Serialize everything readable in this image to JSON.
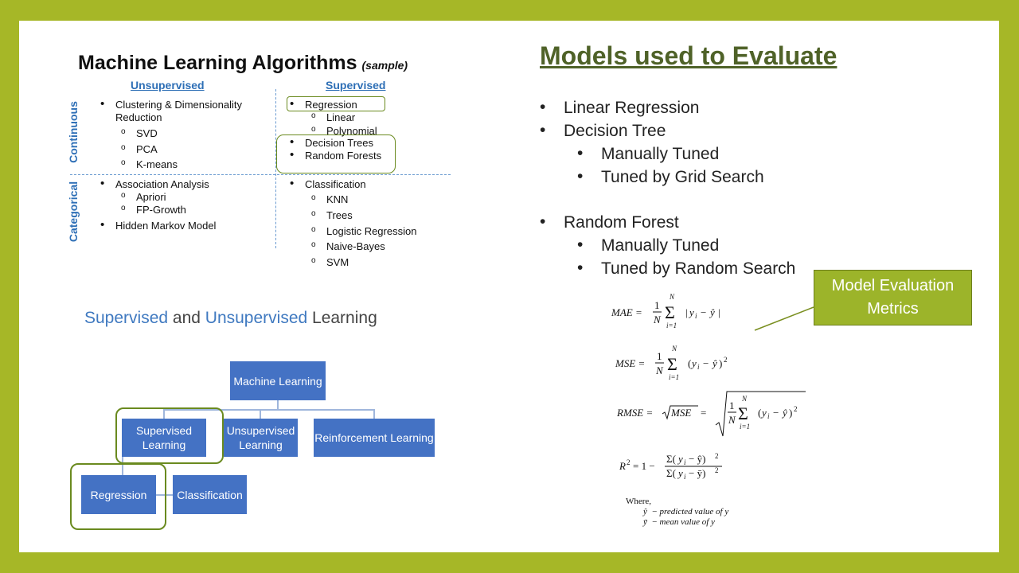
{
  "ml_chart": {
    "title": "Machine Learning Algorithms",
    "title_note": "(sample)",
    "col_unsupervised": "Unsupervised",
    "col_supervised": "Supervised",
    "row_continuous": "Continuous",
    "row_categorical": "Categorical",
    "unsup_continuous": {
      "item": "Clustering & Dimensionality",
      "item_line2": "Reduction",
      "subs": [
        "SVD",
        "PCA",
        "K-means"
      ]
    },
    "sup_continuous": {
      "regression": "Regression",
      "regression_subs": [
        "Linear",
        "Polynomial"
      ],
      "trees": "Decision Trees",
      "forests": "Random Forests"
    },
    "unsup_categorical": {
      "item": "Association Analysis",
      "subs": [
        "Apriori",
        "FP-Growth"
      ],
      "item2": "Hidden Markov Model"
    },
    "sup_categorical": {
      "item": "Classification",
      "subs": [
        "KNN",
        "Trees",
        "Logistic Regression",
        "Naive-Bayes",
        "SVM"
      ]
    }
  },
  "su_diagram": {
    "title_part1": "Supervised",
    "title_part2": " and ",
    "title_part3": "Unsupervised",
    "title_part4": " Learning",
    "root": "Machine Learning",
    "supervised": "Supervised Learning",
    "unsupervised": "Unsupervised Learning",
    "reinforcement": "Reinforcement Learning",
    "regression": "Regression",
    "classification": "Classification"
  },
  "models": {
    "title": "Models used to Evaluate",
    "items": [
      "Linear Regression",
      "Decision Tree",
      "Manually Tuned",
      "Tuned by Grid Search",
      "Random Forest",
      "Manually Tuned",
      "Tuned by Random Search"
    ]
  },
  "callout": "Model Evaluation Metrics",
  "formulas": {
    "where": "Where,",
    "yhat_def": "ŷ  − predicted value of y",
    "ybar_def": "ȳ  − mean value of y"
  },
  "colors": {
    "background": "#a6b727",
    "accent_blue": "#4472c4",
    "title_green": "#4f6228",
    "highlight": "#6a8a1f"
  }
}
